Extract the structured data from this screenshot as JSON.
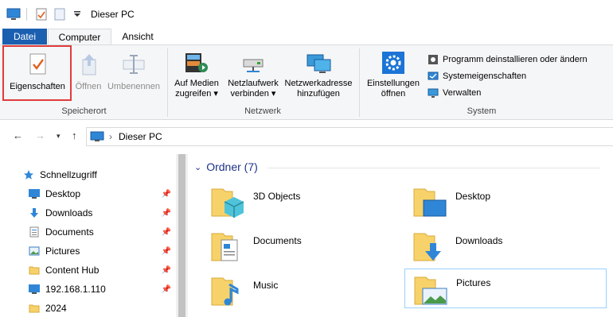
{
  "window": {
    "title": "Dieser PC"
  },
  "ribbon_tabs": {
    "file": "Datei",
    "computer": "Computer",
    "view": "Ansicht"
  },
  "ribbon": {
    "location": {
      "properties": "Eigenschaften",
      "open": "Öffnen",
      "rename": "Umbenennen",
      "group": "Speicherort"
    },
    "network": {
      "map_media_line1": "Auf Medien",
      "map_media_line2": "zugreifen",
      "map_drive_line1": "Netzlaufwerk",
      "map_drive_line2": "verbinden",
      "add_location_line1": "Netzwerkadresse",
      "add_location_line2": "hinzufügen",
      "group": "Netzwerk"
    },
    "system": {
      "settings_line1": "Einstellungen",
      "settings_line2": "öffnen",
      "uninstall": "Programm deinstallieren oder ändern",
      "system_props": "Systemeigenschaften",
      "manage": "Verwalten",
      "group": "System"
    }
  },
  "address": {
    "crumb": "Dieser PC",
    "separator": "›"
  },
  "nav": {
    "quick_access": "Schnellzugriff",
    "items": [
      {
        "label": "Desktop",
        "icon": "desktop-icon"
      },
      {
        "label": "Downloads",
        "icon": "downloads-icon"
      },
      {
        "label": "Documents",
        "icon": "documents-icon"
      },
      {
        "label": "Pictures",
        "icon": "pictures-icon"
      },
      {
        "label": "Content Hub",
        "icon": "folder-icon"
      },
      {
        "label": "192.168.1.110",
        "icon": "network-computer-icon"
      },
      {
        "label": "2024",
        "icon": "folder-icon"
      }
    ]
  },
  "content": {
    "group_title": "Ordner (7)",
    "folders": [
      {
        "label": "3D Objects"
      },
      {
        "label": "Desktop"
      },
      {
        "label": "Documents"
      },
      {
        "label": "Downloads"
      },
      {
        "label": "Music"
      },
      {
        "label": "Pictures"
      }
    ]
  },
  "colors": {
    "accent": "#1b5fb0",
    "highlight": "#e03c3c",
    "folder": "#f7d26a"
  }
}
